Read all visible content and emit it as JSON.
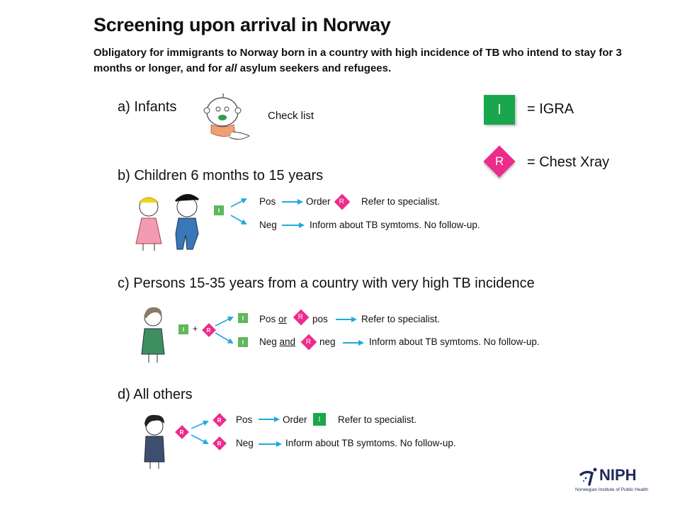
{
  "header": {
    "title": "Screening upon arrival in Norway",
    "subtitle_part1": "Obligatory for immigrants to Norway born in a country with high incidence of TB who intend to stay for 3 months or longer, and for ",
    "subtitle_italic": "all",
    "subtitle_part2": " asylum seekers and refugees."
  },
  "legend": {
    "igra": {
      "symbol": "I",
      "label": "= IGRA",
      "color": "#1aa64c"
    },
    "xray": {
      "symbol": "R",
      "label": "= Chest Xray",
      "color": "#ec2c8b"
    }
  },
  "arrow_color": "#1fa9e1",
  "sections": {
    "a": {
      "heading": "a) Infants",
      "note": "Check list",
      "illustration": "infant-illustration"
    },
    "b": {
      "heading": "b) Children  6 months to 15 years",
      "start": "I",
      "pos": {
        "label": "Pos",
        "action": "Order",
        "test": "R",
        "result": "Refer to specialist."
      },
      "neg": {
        "label": "Neg",
        "result": "Inform about TB symtoms. No follow-up."
      }
    },
    "c": {
      "heading": "c)  Persons 15-35 years from a country with very high TB incidence",
      "start1": "I",
      "plus": "+",
      "start2": "R",
      "pos": {
        "test": "I",
        "label": "Pos",
        "conj": "or",
        "test2": "R",
        "label2": "pos",
        "result": "Refer to specialist."
      },
      "neg": {
        "test": "I",
        "label": "Neg",
        "conj": "and",
        "test2": "R",
        "label2": "neg",
        "result": "Inform about TB symtoms. No follow-up."
      }
    },
    "d": {
      "heading": "d) All others",
      "start": "R",
      "pos": {
        "test": "R",
        "label": "Pos",
        "action": "Order",
        "test2": "I",
        "result": "Refer to specialist."
      },
      "neg": {
        "test": "R",
        "label": "Neg",
        "result": "Inform about TB symtoms. No follow-up."
      }
    }
  },
  "footer": {
    "logo_text": "NIPH",
    "logo_subtext": "Norwegian Institute of Public Health"
  }
}
